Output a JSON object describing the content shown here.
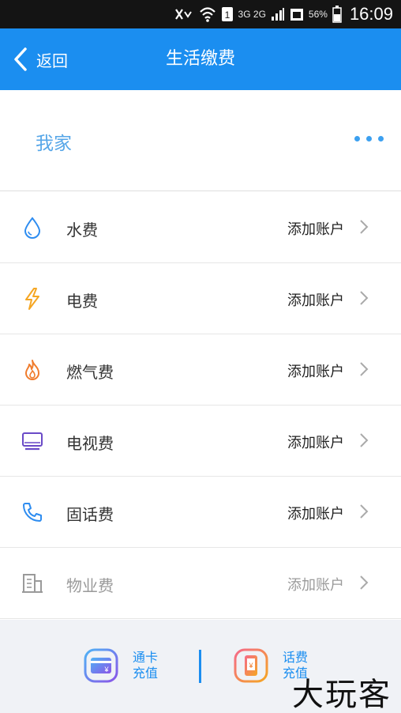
{
  "status_bar": {
    "network": "3G 2G",
    "battery": "56%",
    "time": "16:09"
  },
  "nav": {
    "back_label": "返回",
    "title": "生活缴费"
  },
  "home": {
    "label": "我家"
  },
  "items": [
    {
      "name": "水费",
      "action": "添加账户",
      "icon": "water-drop-icon",
      "color": "#2d8cf0"
    },
    {
      "name": "电费",
      "action": "添加账户",
      "icon": "lightning-icon",
      "color": "#f5a623"
    },
    {
      "name": "燃气费",
      "action": "添加账户",
      "icon": "flame-icon",
      "color": "#f07c2d"
    },
    {
      "name": "电视费",
      "action": "添加账户",
      "icon": "tv-icon",
      "color": "#6a4ac7"
    },
    {
      "name": "固话费",
      "action": "添加账户",
      "icon": "phone-icon",
      "color": "#2d8cf0"
    },
    {
      "name": "物业费",
      "action": "添加账户",
      "icon": "building-icon",
      "color": "#9a9a9a"
    }
  ],
  "bottom": {
    "card_line1": "通卡",
    "card_line2": "充值",
    "phone_line1": "话费",
    "phone_line2": "充值"
  },
  "watermark": "大玩客",
  "colors": {
    "accent": "#1b8ef0",
    "home_label": "#56a6e8"
  }
}
